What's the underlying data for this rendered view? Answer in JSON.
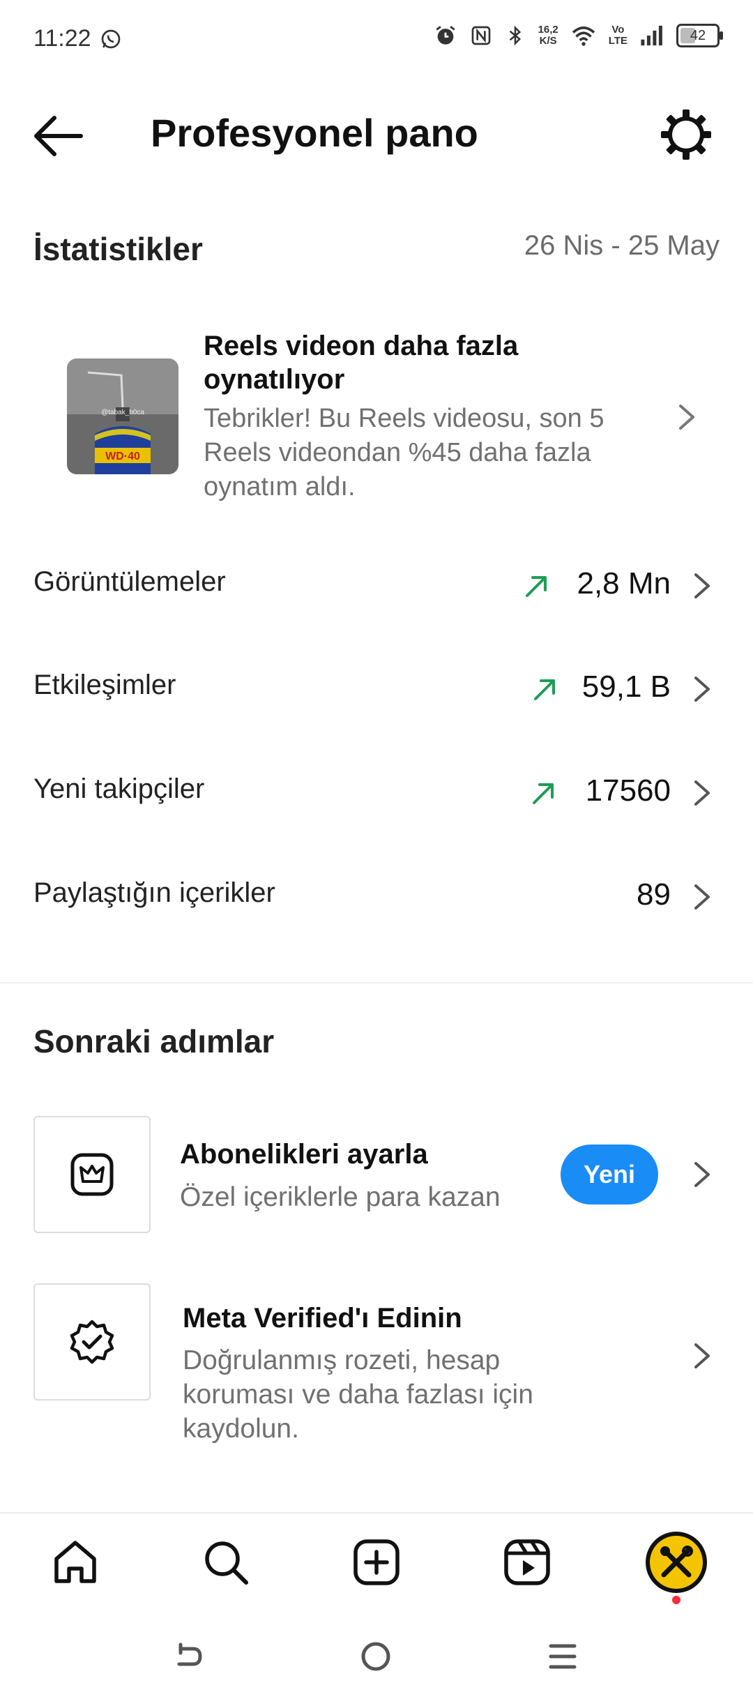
{
  "status_bar": {
    "time": "11:22",
    "net_speed_top": "16,2",
    "net_speed_bottom": "K/S",
    "volte_top": "Vo",
    "volte_bottom": "LTE",
    "battery": "42",
    "battery_level_pct": 42,
    "icons": [
      "whatsapp-icon",
      "alarm-icon",
      "nfc-icon",
      "bluetooth-icon",
      "wifi-icon",
      "signal-icon",
      "battery-icon"
    ]
  },
  "header": {
    "title": "Profesyonel pano"
  },
  "insights": {
    "heading": "İstatistikler",
    "date_range": "26 Nis - 25 May",
    "reels_card": {
      "title": "Reels videon daha fazla oynatılıyor",
      "body": "Tebrikler! Bu Reels videosu, son 5 Reels videondan %45 daha fazla oynatım aldı.",
      "thumb_caption": "@tabak_b0ca"
    },
    "stats": [
      {
        "label": "Görüntülemeler",
        "value": "2,8 Mn",
        "trend": "up"
      },
      {
        "label": "Etkileşimler",
        "value": "59,1 B",
        "trend": "up"
      },
      {
        "label": "Yeni takipçiler",
        "value": "17560",
        "trend": "up"
      },
      {
        "label": "Paylaştığın içerikler",
        "value": "89",
        "trend": "none"
      }
    ],
    "trend_color": "#1f9d55"
  },
  "next_steps": {
    "heading": "Sonraki adımlar",
    "items": [
      {
        "title": "Abonelikleri ayarla",
        "desc": "Özel içeriklerle para kazan",
        "badge": "Yeni"
      },
      {
        "title": "Meta Verified'ı Edinin",
        "desc": "Doğrulanmış rozeti, hesap koruması ve daha fazlası için kaydolun."
      }
    ]
  },
  "bottom_nav": [
    "home-icon",
    "search-icon",
    "create-icon",
    "reels-icon",
    "profile-avatar"
  ],
  "colors": {
    "accent": "#1a8cf5",
    "notification": "#ff2a3a",
    "avatar_bg": "#f5c400"
  }
}
